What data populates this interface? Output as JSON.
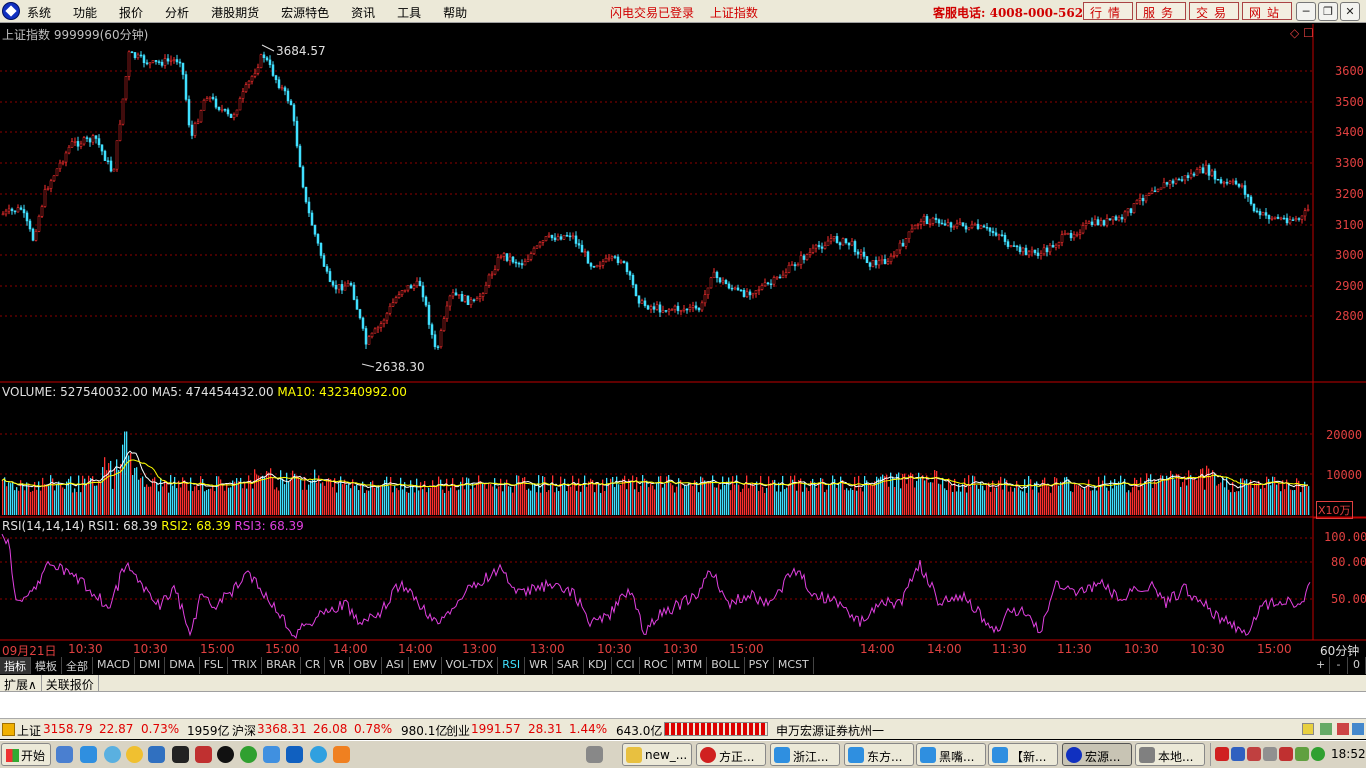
{
  "menubar": {
    "items": [
      "系统",
      "功能",
      "报价",
      "分析",
      "港股期货",
      "宏源特色",
      "资讯",
      "工具",
      "帮助"
    ],
    "status": [
      "闪电交易已登录",
      "上证指数"
    ],
    "hotline": "客服电话: 4008-000-562",
    "nav_buttons": [
      "行情",
      "服务",
      "交易",
      "网站"
    ],
    "window_controls": [
      "─",
      "❐",
      "✕"
    ]
  },
  "price_panel": {
    "title": "上证指数 999999(60分钟)",
    "high_label": "3684.57",
    "low_label": "2638.30",
    "corner_icons": "◇ ☐",
    "y_ticks": [
      "3600",
      "3500",
      "3400",
      "3300",
      "3200",
      "3100",
      "3000",
      "2900",
      "2800"
    ]
  },
  "volume_panel": {
    "volume_label": "VOLUME: 527540032.00",
    "ma5_label": "MA5: 474454432.00",
    "ma10_label": "MA10: 432340992.00",
    "y_ticks": [
      "20000",
      "10000"
    ],
    "unit": "X10万"
  },
  "rsi_panel": {
    "title": "RSI(14,14,14)",
    "rsi1_label": "RSI1: 68.39",
    "rsi2_label": "RSI2: 68.39",
    "rsi3_label": "RSI3: 68.39",
    "y_ticks": [
      "100.00",
      "80.00",
      "50.00"
    ]
  },
  "time_axis": {
    "labels": [
      "09月21日",
      "10:30",
      "10:30",
      "15:00",
      "15:00",
      "14:00",
      "14:00",
      "13:00",
      "13:00",
      "10:30",
      "10:30",
      "15:00",
      "14:00",
      "14:00",
      "11:30",
      "11:30",
      "10:30",
      "10:30",
      "15:00"
    ],
    "period": "60分钟"
  },
  "indicator_tabs": {
    "items": [
      "指标",
      "模板",
      "全部",
      "MACD",
      "DMI",
      "DMA",
      "FSL",
      "TRIX",
      "BRAR",
      "CR",
      "VR",
      "OBV",
      "ASI",
      "EMV",
      "VOL-TDX",
      "RSI",
      "WR",
      "SAR",
      "KDJ",
      "CCI",
      "ROC",
      "MTM",
      "BOLL",
      "PSY",
      "MCST"
    ],
    "active": "RSI",
    "right_controls": [
      "+",
      "-",
      "0"
    ]
  },
  "expand_bar": {
    "items": [
      "扩展∧",
      "关联报价"
    ]
  },
  "ticker": {
    "sh_name": "上证",
    "sh_price": "3158.79",
    "sh_change": "22.87",
    "sh_pct": "0.73%",
    "sh_amount": "1959亿",
    "hs_name": "沪深",
    "hs_price": "3368.31",
    "hs_change": "26.08",
    "hs_pct": "0.78%",
    "hs_amount": "980.1亿",
    "cy_name": "创业",
    "cy_price": "1991.57",
    "cy_change": "28.31",
    "cy_pct": "1.44%",
    "cy_amount": "643.0亿",
    "broker": "申万宏源证券杭州一"
  },
  "taskbar": {
    "start": "开始",
    "windows": [
      "new_...",
      "方正...",
      "浙江...",
      "东方...",
      "黑嘴...",
      "【新...",
      "宏源...",
      "本地..."
    ],
    "clock": "18:52"
  },
  "colors": {
    "up": "#ff3030",
    "down": "#40e0ff",
    "ma5": "#ffffff",
    "ma10": "#ffff00",
    "rsi": "#e040e0",
    "grid": "#8b0000"
  }
}
